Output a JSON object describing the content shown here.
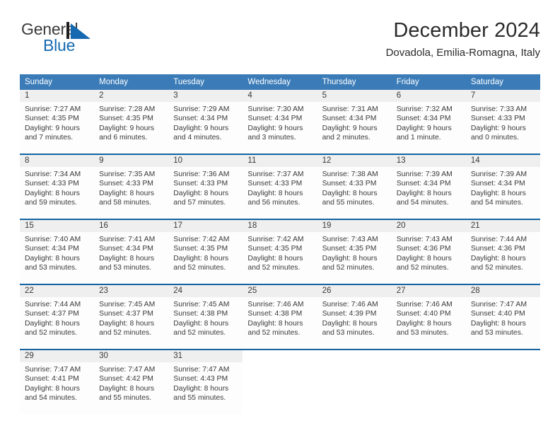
{
  "brand": {
    "name_part1": "General",
    "name_part2": "Blue",
    "mark_icon": "blue-triangle-flag-icon"
  },
  "header": {
    "title": "December 2024",
    "location": "Dovadola, Emilia-Romagna, Italy"
  },
  "colors": {
    "weekday_header_bg": "#3b7cb8",
    "week_divider": "#14639f",
    "daynum_band": "#efefef",
    "brand_blue": "#1569b0",
    "text": "#3a3a3a"
  },
  "weekdays": [
    "Sunday",
    "Monday",
    "Tuesday",
    "Wednesday",
    "Thursday",
    "Friday",
    "Saturday"
  ],
  "weeks": [
    [
      {
        "day": "1",
        "sunrise": "Sunrise: 7:27 AM",
        "sunset": "Sunset: 4:35 PM",
        "daylight1": "Daylight: 9 hours",
        "daylight2": "and 7 minutes."
      },
      {
        "day": "2",
        "sunrise": "Sunrise: 7:28 AM",
        "sunset": "Sunset: 4:35 PM",
        "daylight1": "Daylight: 9 hours",
        "daylight2": "and 6 minutes."
      },
      {
        "day": "3",
        "sunrise": "Sunrise: 7:29 AM",
        "sunset": "Sunset: 4:34 PM",
        "daylight1": "Daylight: 9 hours",
        "daylight2": "and 4 minutes."
      },
      {
        "day": "4",
        "sunrise": "Sunrise: 7:30 AM",
        "sunset": "Sunset: 4:34 PM",
        "daylight1": "Daylight: 9 hours",
        "daylight2": "and 3 minutes."
      },
      {
        "day": "5",
        "sunrise": "Sunrise: 7:31 AM",
        "sunset": "Sunset: 4:34 PM",
        "daylight1": "Daylight: 9 hours",
        "daylight2": "and 2 minutes."
      },
      {
        "day": "6",
        "sunrise": "Sunrise: 7:32 AM",
        "sunset": "Sunset: 4:34 PM",
        "daylight1": "Daylight: 9 hours",
        "daylight2": "and 1 minute."
      },
      {
        "day": "7",
        "sunrise": "Sunrise: 7:33 AM",
        "sunset": "Sunset: 4:33 PM",
        "daylight1": "Daylight: 9 hours",
        "daylight2": "and 0 minutes."
      }
    ],
    [
      {
        "day": "8",
        "sunrise": "Sunrise: 7:34 AM",
        "sunset": "Sunset: 4:33 PM",
        "daylight1": "Daylight: 8 hours",
        "daylight2": "and 59 minutes."
      },
      {
        "day": "9",
        "sunrise": "Sunrise: 7:35 AM",
        "sunset": "Sunset: 4:33 PM",
        "daylight1": "Daylight: 8 hours",
        "daylight2": "and 58 minutes."
      },
      {
        "day": "10",
        "sunrise": "Sunrise: 7:36 AM",
        "sunset": "Sunset: 4:33 PM",
        "daylight1": "Daylight: 8 hours",
        "daylight2": "and 57 minutes."
      },
      {
        "day": "11",
        "sunrise": "Sunrise: 7:37 AM",
        "sunset": "Sunset: 4:33 PM",
        "daylight1": "Daylight: 8 hours",
        "daylight2": "and 56 minutes."
      },
      {
        "day": "12",
        "sunrise": "Sunrise: 7:38 AM",
        "sunset": "Sunset: 4:33 PM",
        "daylight1": "Daylight: 8 hours",
        "daylight2": "and 55 minutes."
      },
      {
        "day": "13",
        "sunrise": "Sunrise: 7:39 AM",
        "sunset": "Sunset: 4:34 PM",
        "daylight1": "Daylight: 8 hours",
        "daylight2": "and 54 minutes."
      },
      {
        "day": "14",
        "sunrise": "Sunrise: 7:39 AM",
        "sunset": "Sunset: 4:34 PM",
        "daylight1": "Daylight: 8 hours",
        "daylight2": "and 54 minutes."
      }
    ],
    [
      {
        "day": "15",
        "sunrise": "Sunrise: 7:40 AM",
        "sunset": "Sunset: 4:34 PM",
        "daylight1": "Daylight: 8 hours",
        "daylight2": "and 53 minutes."
      },
      {
        "day": "16",
        "sunrise": "Sunrise: 7:41 AM",
        "sunset": "Sunset: 4:34 PM",
        "daylight1": "Daylight: 8 hours",
        "daylight2": "and 53 minutes."
      },
      {
        "day": "17",
        "sunrise": "Sunrise: 7:42 AM",
        "sunset": "Sunset: 4:35 PM",
        "daylight1": "Daylight: 8 hours",
        "daylight2": "and 52 minutes."
      },
      {
        "day": "18",
        "sunrise": "Sunrise: 7:42 AM",
        "sunset": "Sunset: 4:35 PM",
        "daylight1": "Daylight: 8 hours",
        "daylight2": "and 52 minutes."
      },
      {
        "day": "19",
        "sunrise": "Sunrise: 7:43 AM",
        "sunset": "Sunset: 4:35 PM",
        "daylight1": "Daylight: 8 hours",
        "daylight2": "and 52 minutes."
      },
      {
        "day": "20",
        "sunrise": "Sunrise: 7:43 AM",
        "sunset": "Sunset: 4:36 PM",
        "daylight1": "Daylight: 8 hours",
        "daylight2": "and 52 minutes."
      },
      {
        "day": "21",
        "sunrise": "Sunrise: 7:44 AM",
        "sunset": "Sunset: 4:36 PM",
        "daylight1": "Daylight: 8 hours",
        "daylight2": "and 52 minutes."
      }
    ],
    [
      {
        "day": "22",
        "sunrise": "Sunrise: 7:44 AM",
        "sunset": "Sunset: 4:37 PM",
        "daylight1": "Daylight: 8 hours",
        "daylight2": "and 52 minutes."
      },
      {
        "day": "23",
        "sunrise": "Sunrise: 7:45 AM",
        "sunset": "Sunset: 4:37 PM",
        "daylight1": "Daylight: 8 hours",
        "daylight2": "and 52 minutes."
      },
      {
        "day": "24",
        "sunrise": "Sunrise: 7:45 AM",
        "sunset": "Sunset: 4:38 PM",
        "daylight1": "Daylight: 8 hours",
        "daylight2": "and 52 minutes."
      },
      {
        "day": "25",
        "sunrise": "Sunrise: 7:46 AM",
        "sunset": "Sunset: 4:38 PM",
        "daylight1": "Daylight: 8 hours",
        "daylight2": "and 52 minutes."
      },
      {
        "day": "26",
        "sunrise": "Sunrise: 7:46 AM",
        "sunset": "Sunset: 4:39 PM",
        "daylight1": "Daylight: 8 hours",
        "daylight2": "and 53 minutes."
      },
      {
        "day": "27",
        "sunrise": "Sunrise: 7:46 AM",
        "sunset": "Sunset: 4:40 PM",
        "daylight1": "Daylight: 8 hours",
        "daylight2": "and 53 minutes."
      },
      {
        "day": "28",
        "sunrise": "Sunrise: 7:47 AM",
        "sunset": "Sunset: 4:40 PM",
        "daylight1": "Daylight: 8 hours",
        "daylight2": "and 53 minutes."
      }
    ],
    [
      {
        "day": "29",
        "sunrise": "Sunrise: 7:47 AM",
        "sunset": "Sunset: 4:41 PM",
        "daylight1": "Daylight: 8 hours",
        "daylight2": "and 54 minutes."
      },
      {
        "day": "30",
        "sunrise": "Sunrise: 7:47 AM",
        "sunset": "Sunset: 4:42 PM",
        "daylight1": "Daylight: 8 hours",
        "daylight2": "and 55 minutes."
      },
      {
        "day": "31",
        "sunrise": "Sunrise: 7:47 AM",
        "sunset": "Sunset: 4:43 PM",
        "daylight1": "Daylight: 8 hours",
        "daylight2": "and 55 minutes."
      },
      {
        "day": "",
        "sunrise": "",
        "sunset": "",
        "daylight1": "",
        "daylight2": ""
      },
      {
        "day": "",
        "sunrise": "",
        "sunset": "",
        "daylight1": "",
        "daylight2": ""
      },
      {
        "day": "",
        "sunrise": "",
        "sunset": "",
        "daylight1": "",
        "daylight2": ""
      },
      {
        "day": "",
        "sunrise": "",
        "sunset": "",
        "daylight1": "",
        "daylight2": ""
      }
    ]
  ]
}
